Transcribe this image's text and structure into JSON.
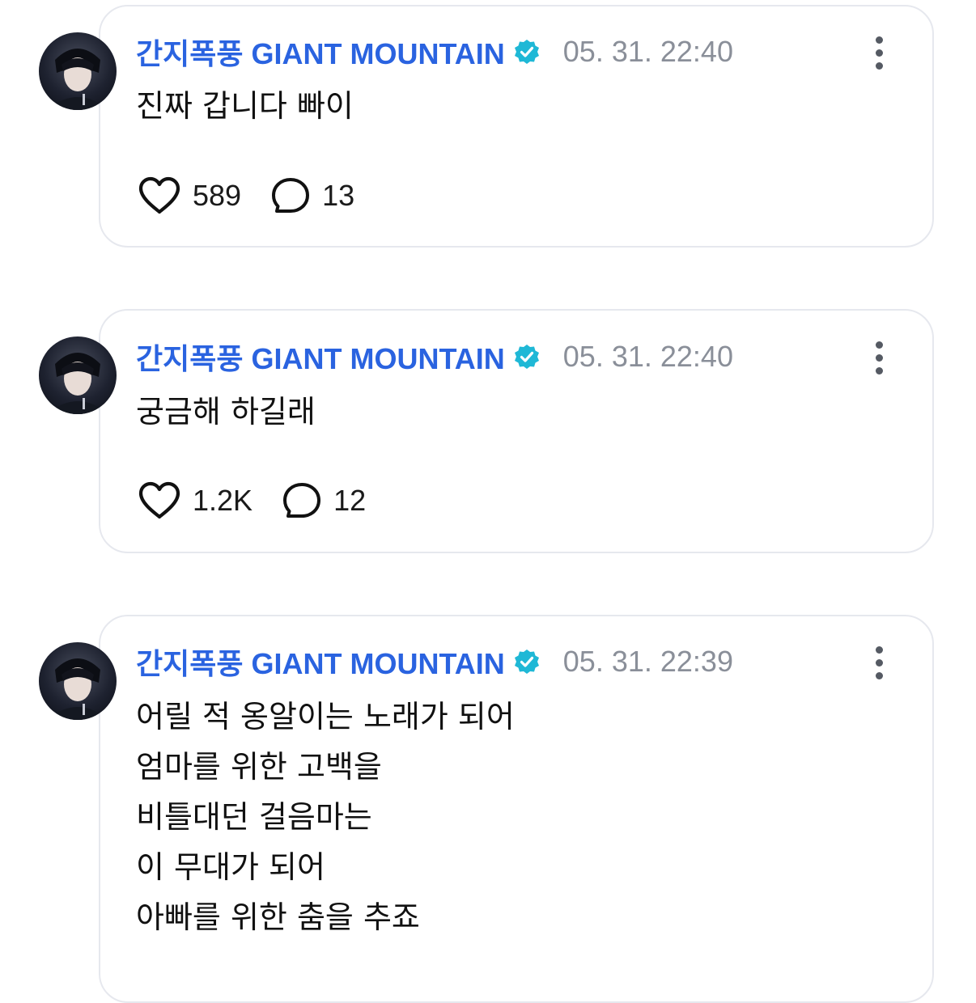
{
  "posts": [
    {
      "author": "간지폭풍 GIANT MOUNTAIN",
      "time": "05. 31. 22:40",
      "lines": [
        "진짜 갑니다 빠이"
      ],
      "likes": "589",
      "comments": "13"
    },
    {
      "author": "간지폭풍 GIANT MOUNTAIN",
      "time": "05. 31. 22:40",
      "lines": [
        "궁금해 하길래"
      ],
      "likes": "1.2K",
      "comments": "12"
    },
    {
      "author": "간지폭풍 GIANT MOUNTAIN",
      "time": "05. 31. 22:39",
      "lines": [
        "어릴 적 옹알이는 노래가 되어",
        "엄마를 위한 고백을",
        "비틀대던 걸음마는",
        "이 무대가 되어",
        "아빠를 위한 춤을 추죠"
      ]
    }
  ],
  "icons": {
    "verified": "verified-badge-icon",
    "like": "heart-icon",
    "comment": "speech-bubble-icon",
    "more": "vertical-dots-icon"
  },
  "colors": {
    "author": "#2a63e0",
    "verified": "#1fb8d6",
    "timestamp": "#8a8f99",
    "card_border": "#e6e8ee"
  }
}
